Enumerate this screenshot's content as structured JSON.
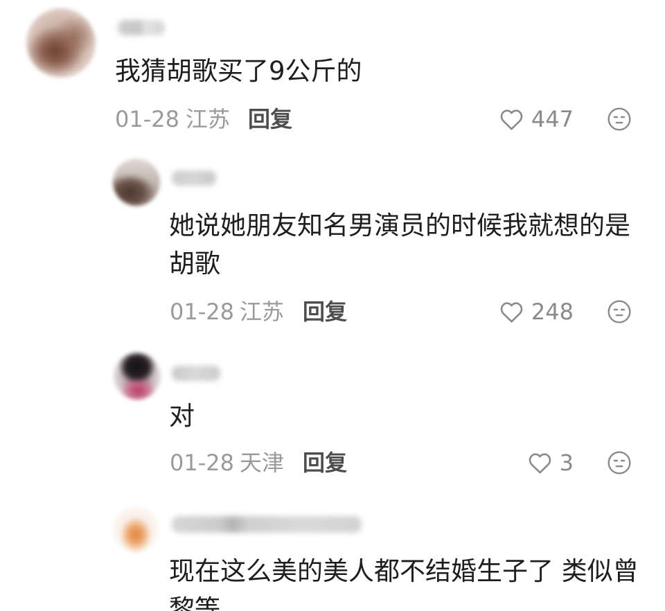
{
  "thread": {
    "comment": {
      "text_lines": [
        "我猜胡歌买了9公斤的"
      ],
      "date": "01-28",
      "location": "江苏",
      "reply_label": "回复",
      "like_count": "447"
    },
    "replies": [
      {
        "text_lines": [
          "她说她朋友知名男演员的时候我就想的是",
          "胡歌"
        ],
        "date": "01-28",
        "location": "江苏",
        "reply_label": "回复",
        "like_count": "248"
      },
      {
        "text_lines": [
          "对"
        ],
        "date": "01-28",
        "location": "天津",
        "reply_label": "回复",
        "like_count": "3"
      },
      {
        "text_lines": [
          "现在这么美的美人都不结婚生子了 类似曾",
          "黎等"
        ]
      }
    ]
  },
  "icons": {
    "like": "heart-icon",
    "dislike": "unamused-face-icon"
  },
  "colors": {
    "background": "#ffffff",
    "text": "#1e1e1e",
    "meta": "#9a9a9a",
    "reply_label": "#4d4d4d",
    "icon": "#8a8a8a"
  }
}
